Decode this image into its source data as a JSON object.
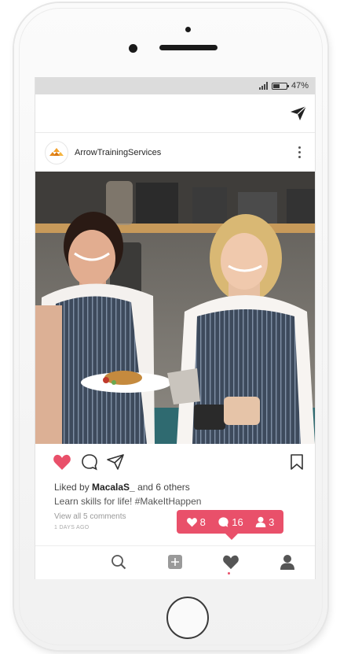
{
  "status": {
    "battery_percent": "47%",
    "battery_level": 0.47
  },
  "post": {
    "username": "ArrowTrainingServices",
    "liked_prefix": "Liked by ",
    "liked_user": "MacalaS_",
    "liked_suffix": " and 6 others",
    "caption": "Learn skills for life! #MakeItHappen",
    "comments_link": "View all 5 comments",
    "time": "1 DAYS AGO"
  },
  "notification": {
    "likes": "8",
    "comments": "16",
    "followers": "3"
  },
  "icons": {
    "send": "paper-plane-icon",
    "more": "kebab-icon",
    "like": "heart-icon",
    "comment": "comment-bubble-icon",
    "share": "paper-plane-icon",
    "save": "bookmark-icon",
    "search": "search-icon",
    "add": "add-post-icon",
    "activity": "heart-icon",
    "profile": "person-icon"
  },
  "colors": {
    "accent": "#e9506a",
    "like": "#e9506a"
  }
}
